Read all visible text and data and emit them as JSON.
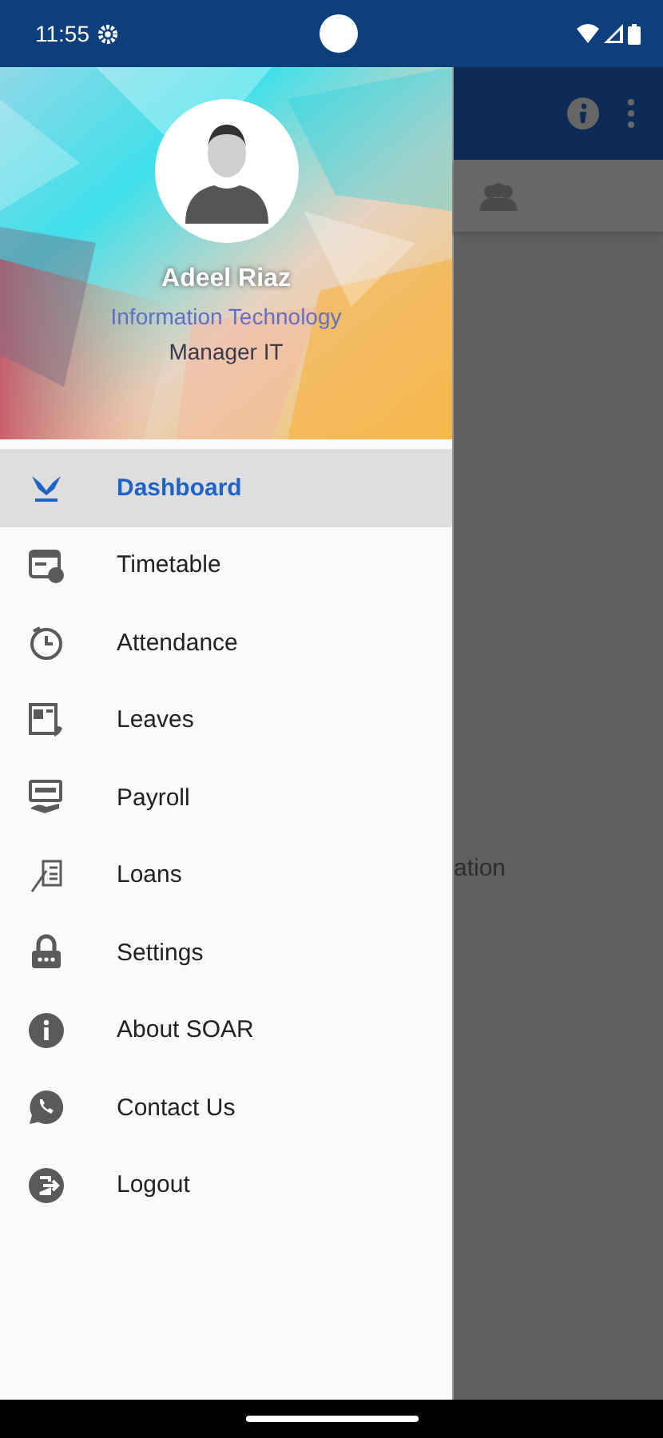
{
  "status_bar": {
    "time": "11:55"
  },
  "drawer": {
    "profile": {
      "name": "Adeel Riaz",
      "department": "Information Technology",
      "title": "Manager IT"
    },
    "items": [
      {
        "label": "Dashboard",
        "selected": true
      },
      {
        "label": "Timetable",
        "selected": false
      },
      {
        "label": "Attendance",
        "selected": false
      },
      {
        "label": "Leaves",
        "selected": false
      },
      {
        "label": "Payroll",
        "selected": false
      },
      {
        "label": "Loans",
        "selected": false
      },
      {
        "label": "Settings",
        "selected": false
      },
      {
        "label": "About SOAR",
        "selected": false
      },
      {
        "label": "Contact Us",
        "selected": false
      },
      {
        "label": "Logout",
        "selected": false
      }
    ]
  },
  "background_screen": {
    "partial_text": "ation"
  }
}
